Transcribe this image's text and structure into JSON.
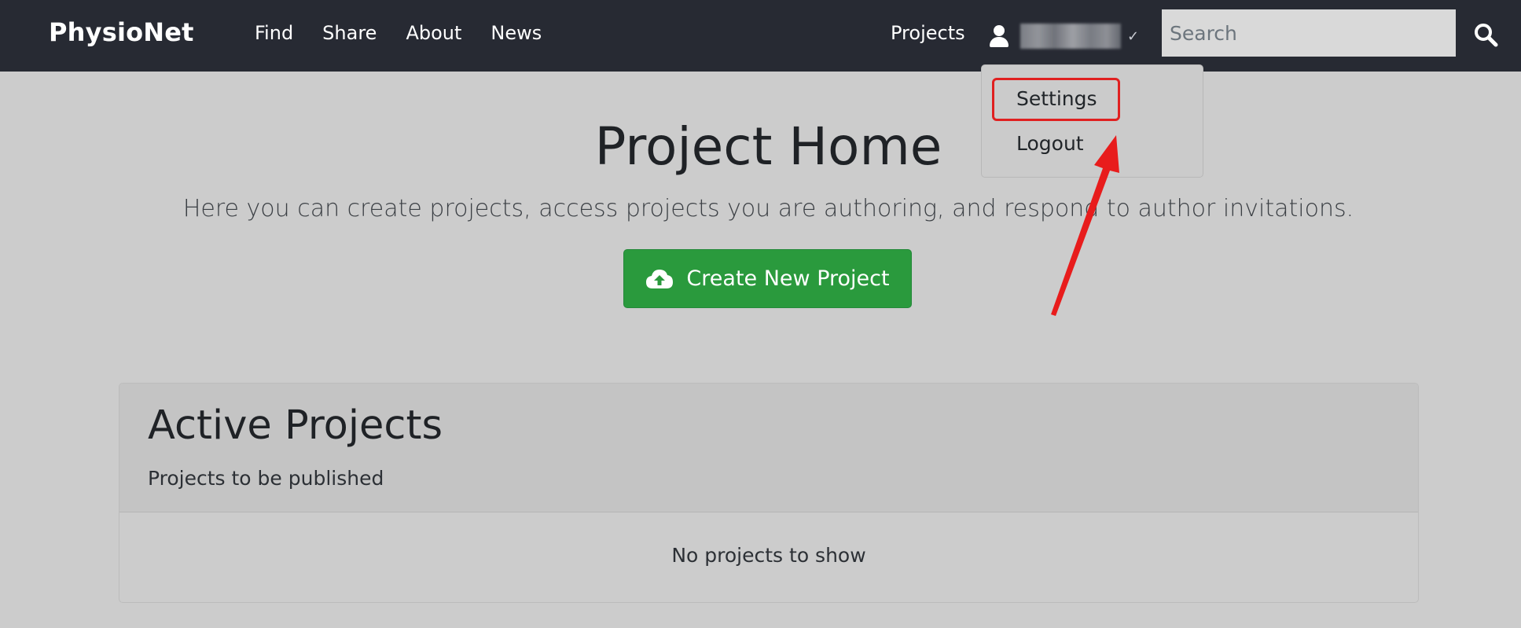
{
  "navbar": {
    "brand": "PhysioNet",
    "links": [
      "Find",
      "Share",
      "About",
      "News"
    ],
    "projects": "Projects",
    "user": {
      "name": "username",
      "caret": "✓"
    },
    "search": {
      "placeholder": "Search",
      "value": ""
    }
  },
  "dropdown": {
    "items": [
      "Settings",
      "Logout"
    ]
  },
  "main": {
    "title": "Project Home",
    "subtitle": "Here you can create projects, access projects you are authoring, and respond to author invitations.",
    "create_button": "Create New Project"
  },
  "card": {
    "title": "Active Projects",
    "subtitle": "Projects to be published",
    "empty": "No projects to show"
  },
  "colors": {
    "navbar": "#272a33",
    "button_green": "#2a9a3d",
    "highlight_red": "#e02020",
    "background": "#cccccc"
  },
  "icons": {
    "user": "user-icon",
    "search": "search-icon",
    "create": "cloud-upload-icon"
  }
}
